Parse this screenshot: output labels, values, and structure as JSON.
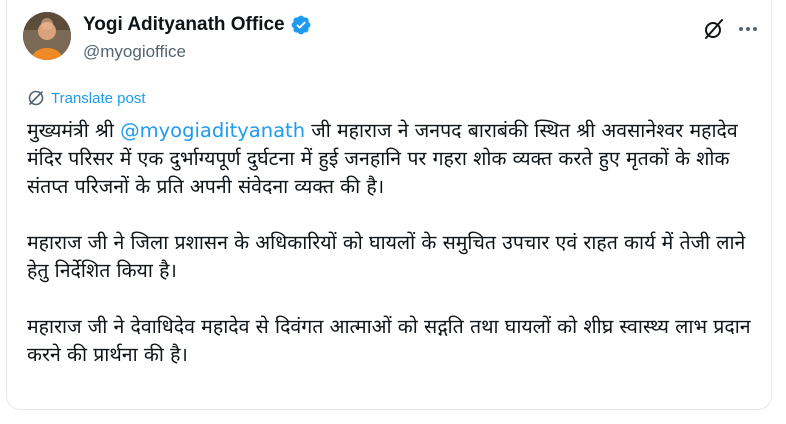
{
  "author": {
    "display_name": "Yogi Adityanath Office",
    "handle": "@myogioffice",
    "verified": true,
    "verified_color": "#1d9bf0"
  },
  "actions": {
    "grok_icon": "grok-slash-icon",
    "more_icon": "more-dots-icon"
  },
  "translate": {
    "label": "Translate post",
    "icon": "globe-translate-icon"
  },
  "tweet": {
    "p1_before": "मुख्यमंत्री श्री ",
    "p1_mention": "@myogiadityanath",
    "p1_after": " जी महाराज ने जनपद बाराबंकी स्थित श्री अवसानेश्वर महादेव मंदिर परिसर में एक दुर्भाग्यपूर्ण दुर्घटना में हुई जनहानि पर गहरा शोक व्यक्त करते हुए मृतकों के शोक संतप्त परिजनों के प्रति अपनी संवेदना व्यक्त की है।",
    "p2": "महाराज जी ने जिला प्रशासन के अधिकारियों को घायलों के समुचित उपचार एवं राहत कार्य में तेजी लाने हेतु निर्देशित किया है।",
    "p3": "महाराज जी ने देवाधिदेव महादेव से दिवंगत आत्माओं को सद्गति तथा घायलों को शीघ्र स्वास्थ्य लाभ प्रदान करने की प्रार्थना की है।"
  },
  "colors": {
    "link": "#1d9bf0",
    "text": "#0f1419",
    "secondary": "#536471"
  }
}
